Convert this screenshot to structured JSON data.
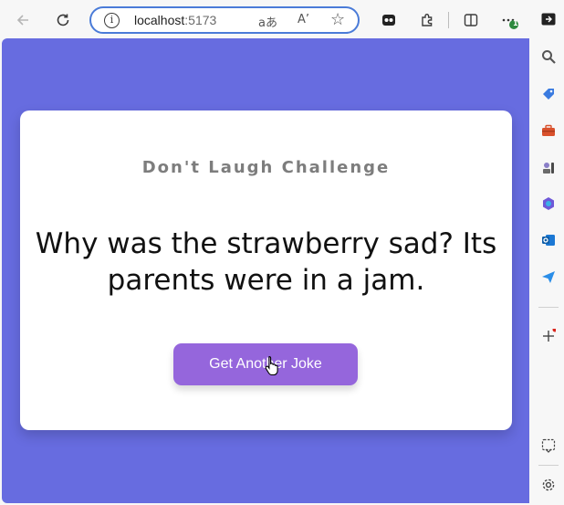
{
  "browser": {
    "url_host": "localhost",
    "url_port": ":5173",
    "info_icon_glyph": "i",
    "read_aloud_glyph": "aあ",
    "read_aloud_text_glyph": "A’",
    "favorite_glyph": "☆",
    "profile_badge": "1"
  },
  "icons": {
    "back": "back-arrow-icon",
    "refresh": "refresh-icon",
    "extensions": "puzzle-icon",
    "split": "split-screen-icon",
    "settings": "gear-icon"
  },
  "page": {
    "card_title": "Don't Laugh Challenge",
    "joke": "Why was the strawberry sad? Its parents were in a jam.",
    "button_label": "Get Another Joke"
  },
  "colors": {
    "page_background": "#676ce0",
    "button_background": "#9566dc",
    "title_color": "#7d7d7d"
  }
}
